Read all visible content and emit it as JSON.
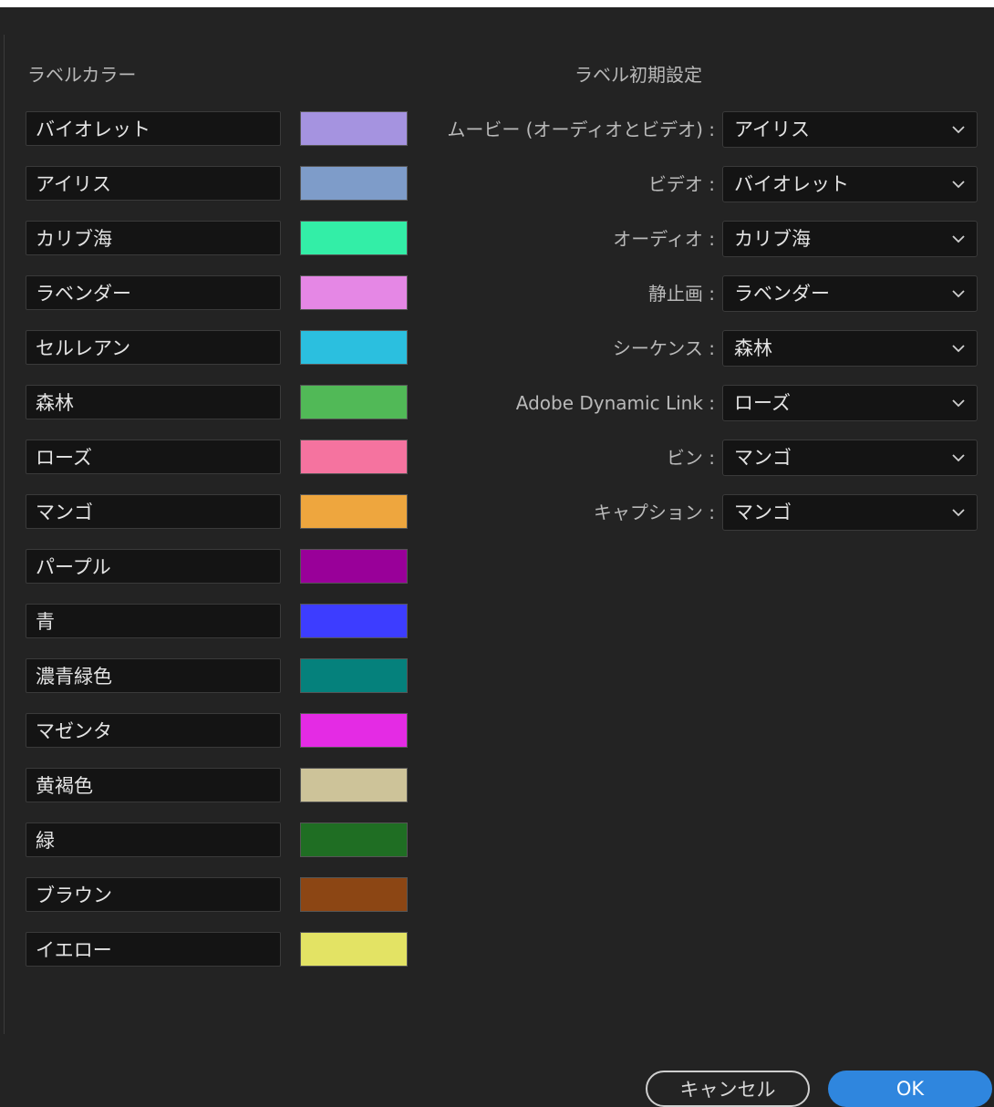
{
  "sections": {
    "label_colors_title": "ラベルカラー",
    "label_defaults_title": "ラベル初期設定"
  },
  "label_colors": [
    {
      "name": "バイオレット",
      "color": "#A593E0"
    },
    {
      "name": "アイリス",
      "color": "#7E9CC9"
    },
    {
      "name": "カリブ海",
      "color": "#33EEA7"
    },
    {
      "name": "ラベンダー",
      "color": "#E587E5"
    },
    {
      "name": "セルレアン",
      "color": "#2BBFDF"
    },
    {
      "name": "森林",
      "color": "#51B957"
    },
    {
      "name": "ローズ",
      "color": "#F5739F"
    },
    {
      "name": "マンゴ",
      "color": "#EEA63E"
    },
    {
      "name": "パープル",
      "color": "#990099"
    },
    {
      "name": "青",
      "color": "#3D3DFF"
    },
    {
      "name": "濃青緑色",
      "color": "#05817C"
    },
    {
      "name": "マゼンタ",
      "color": "#E42BE4"
    },
    {
      "name": "黄褐色",
      "color": "#CDC399"
    },
    {
      "name": "緑",
      "color": "#1F6E23"
    },
    {
      "name": "ブラウン",
      "color": "#8C4614"
    },
    {
      "name": "イエロー",
      "color": "#E3E364"
    }
  ],
  "label_defaults": [
    {
      "label": "ムービー (オーディオとビデオ) :",
      "value": "アイリス"
    },
    {
      "label": "ビデオ :",
      "value": "バイオレット"
    },
    {
      "label": "オーディオ :",
      "value": "カリブ海"
    },
    {
      "label": "静止画 :",
      "value": "ラベンダー"
    },
    {
      "label": "シーケンス :",
      "value": "森林"
    },
    {
      "label": "Adobe Dynamic Link :",
      "value": "ローズ"
    },
    {
      "label": "ビン :",
      "value": "マンゴ"
    },
    {
      "label": "キャプション :",
      "value": "マンゴ"
    }
  ],
  "buttons": {
    "cancel": "キャンセル",
    "ok": "OK"
  },
  "icons": {
    "dropdown_chevron": "chevron-down-icon"
  },
  "accent_color": "#2F86DE"
}
